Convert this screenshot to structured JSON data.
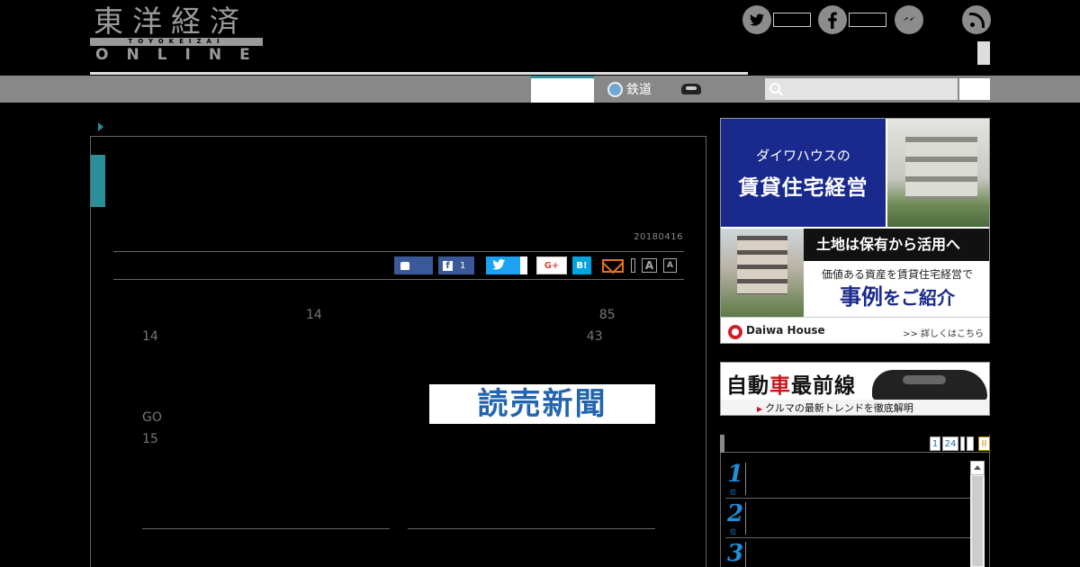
{
  "header": {
    "logo_kanji": "東洋経済",
    "logo_romaji": "TOYOKEIZAI",
    "logo_online": "ONLINE",
    "social_icons": [
      "twitter-icon",
      "facebook-icon",
      "messenger-icon",
      "rss-icon"
    ]
  },
  "nav": {
    "rail_label": "鉄道",
    "search_icon": "search-icon",
    "accent_color": "#2a8f99"
  },
  "article": {
    "date": "20180416",
    "share": {
      "fb_count": "1",
      "gplus_label": "G+",
      "hatena_label": "B!",
      "font_large": "A",
      "font_small": "A"
    },
    "paragraph_1": "　　　　　　　　　　　　　14　　　　　　　　　　　　　　　　　　　　　　85　　　　　　　　　　　　　　　　　　　　　　　　　　14　　　　　　　　　　　　　　　　　　　　　　　　　　　　　　　　　　43　　　　　　　　　",
    "paragraph_2": "　　　　　　　　　　　　　　　　　　　　　　　　　　　　　　　GO　　　　　　　　　　　　　　　　　　　　　　　　　　　　　　　　　　　　15　　　　　　　　　　　　　　　　　　　　　　　　　　　　　　",
    "source_logo": "読売新聞"
  },
  "sidebar": {
    "daiwa": {
      "sub": "ダイワハウスの",
      "main": "賃貸住宅経営",
      "land": "土地は保有から活用へ",
      "value": "価値ある資産を賃貸住宅経営で",
      "case_big": "事例",
      "case_small": "をご紹介",
      "brand": "Daiwa House",
      "detail": ">> 詳しくはこちら"
    },
    "jidousha": {
      "title_1": "自動",
      "title_red": "車",
      "title_2": "最前線",
      "sub": "クルマの最新トレンドを徹底解明"
    },
    "ranking": {
      "tab_1": "1",
      "tab_24": "24",
      "tab_c": "II",
      "items": [
        {
          "num": "1",
          "sub": "位"
        },
        {
          "num": "2",
          "sub": "位"
        },
        {
          "num": "3",
          "sub": "位"
        }
      ]
    }
  }
}
